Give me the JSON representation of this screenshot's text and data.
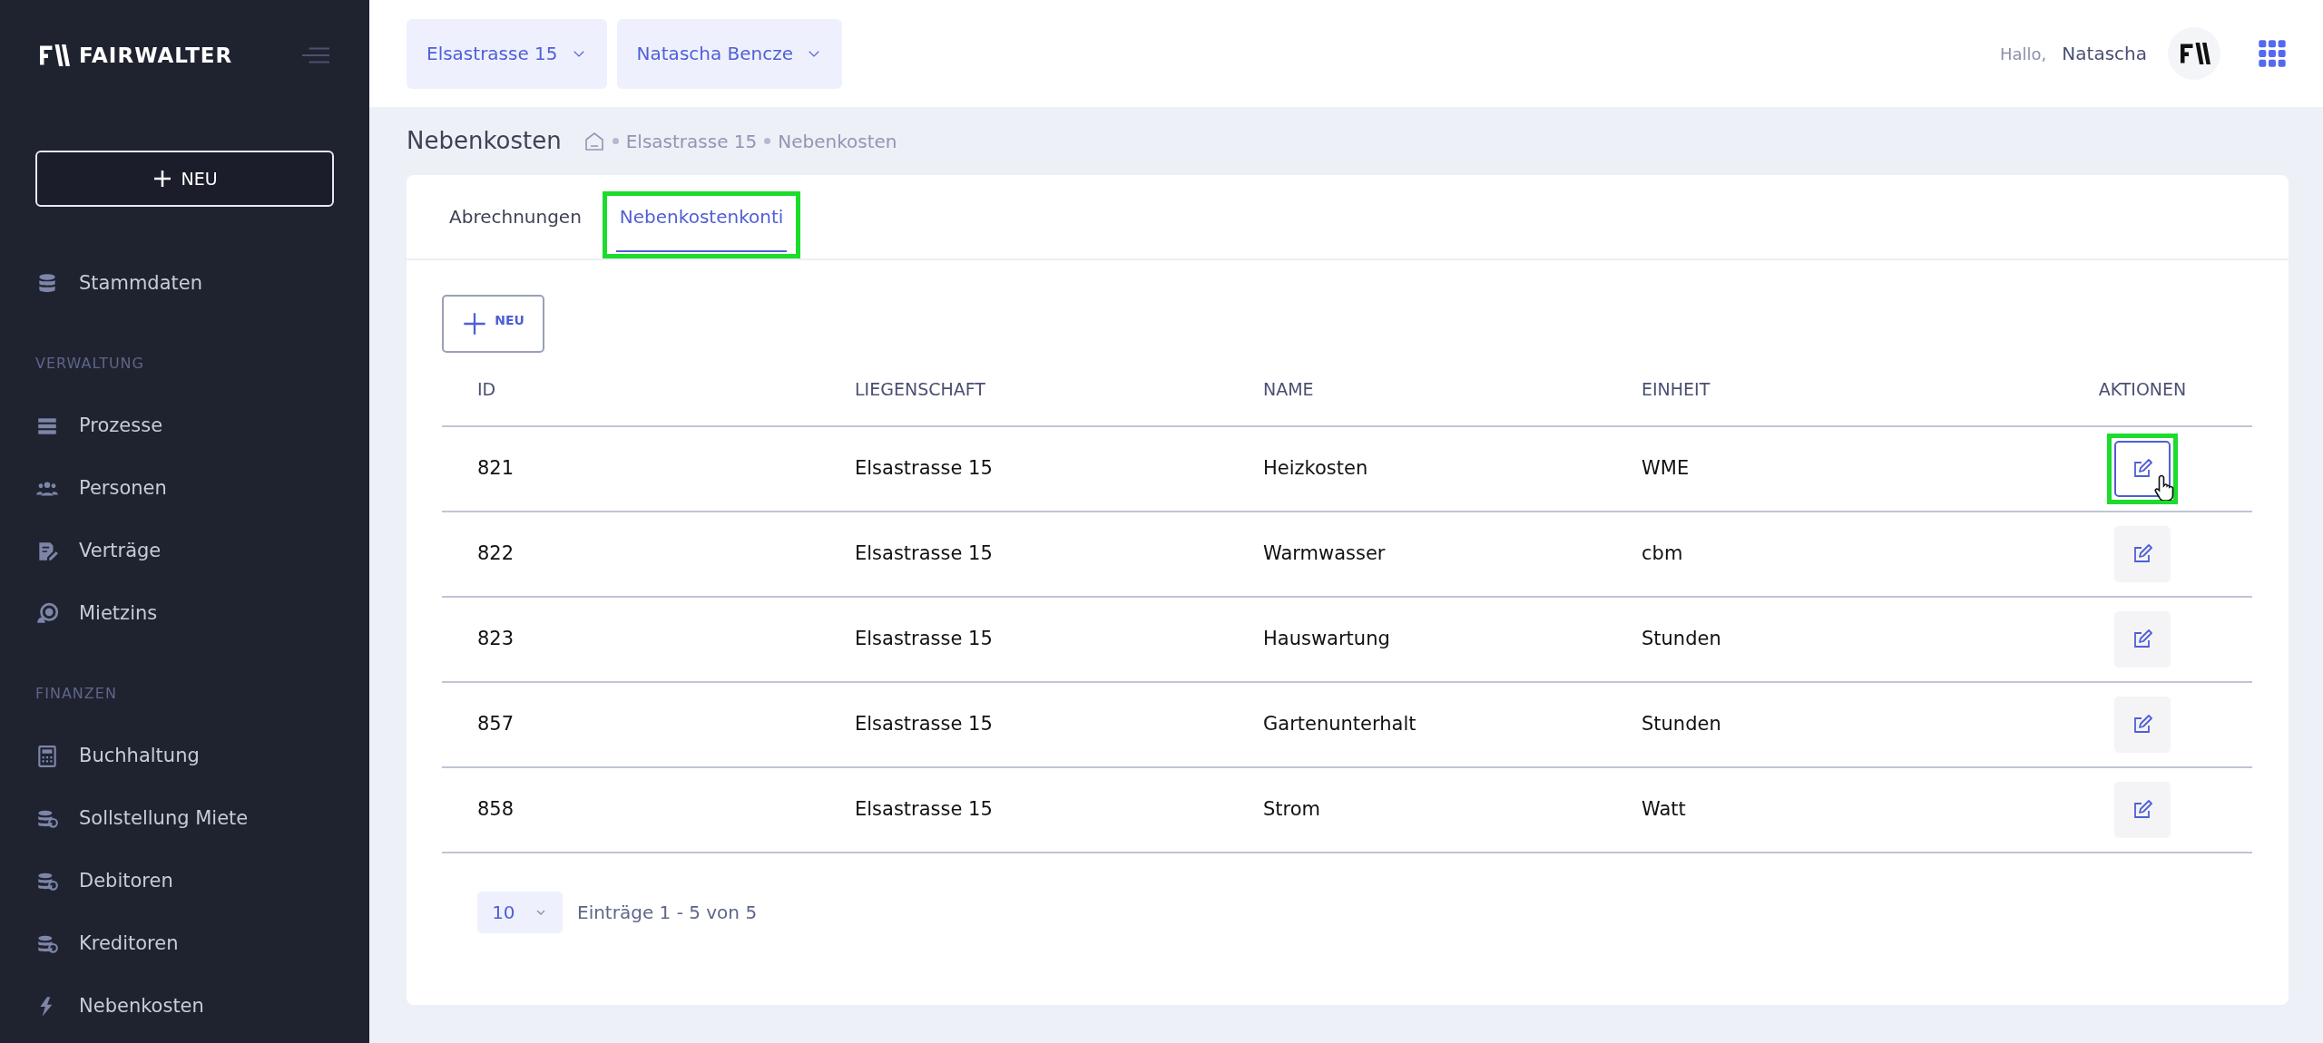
{
  "sidebar": {
    "logo": "FAIRWALTER",
    "new_button": "NEU",
    "sections": [
      {
        "items": [
          {
            "label": "Stammdaten"
          }
        ]
      },
      {
        "heading": "VERWALTUNG",
        "items": [
          {
            "label": "Prozesse"
          },
          {
            "label": "Personen"
          },
          {
            "label": "Verträge"
          },
          {
            "label": "Mietzins"
          }
        ]
      },
      {
        "heading": "FINANZEN",
        "items": [
          {
            "label": "Buchhaltung"
          },
          {
            "label": "Sollstellung Miete"
          },
          {
            "label": "Debitoren"
          },
          {
            "label": "Kreditoren"
          },
          {
            "label": "Nebenkosten"
          }
        ]
      }
    ]
  },
  "topbar": {
    "selectors": [
      {
        "label": "Elsastrasse 15"
      },
      {
        "label": "Natascha Bencze"
      }
    ],
    "greeting": "Hallo,",
    "user": "Natascha"
  },
  "page": {
    "title": "Nebenkosten",
    "breadcrumb": [
      "Elsastrasse 15",
      "Nebenkosten"
    ]
  },
  "tabs": [
    {
      "label": "Abrechnungen",
      "selected": false,
      "highlighted": false
    },
    {
      "label": "Nebenkostenkonti",
      "selected": true,
      "highlighted": true
    }
  ],
  "new_button": "NEU",
  "table": {
    "columns": [
      "ID",
      "LIEGENSCHAFT",
      "NAME",
      "EINHEIT",
      "AKTIONEN"
    ],
    "rows": [
      {
        "cells": [
          "821",
          "Elsastrasse 15",
          "Heizkosten",
          "WME"
        ],
        "hovered": true,
        "highlighted": true
      },
      {
        "cells": [
          "822",
          "Elsastrasse 15",
          "Warmwasser",
          "cbm"
        ],
        "hovered": false,
        "highlighted": false
      },
      {
        "cells": [
          "823",
          "Elsastrasse 15",
          "Hauswartung",
          "Stunden"
        ],
        "hovered": false,
        "highlighted": false
      },
      {
        "cells": [
          "857",
          "Elsastrasse 15",
          "Gartenunterhalt",
          "Stunden"
        ],
        "hovered": false,
        "highlighted": false
      },
      {
        "cells": [
          "858",
          "Elsastrasse 15",
          "Strom",
          "Watt"
        ],
        "hovered": false,
        "highlighted": false
      }
    ]
  },
  "pagination": {
    "page_size": "10",
    "summary": "Einträge 1 - 5 von 5"
  }
}
